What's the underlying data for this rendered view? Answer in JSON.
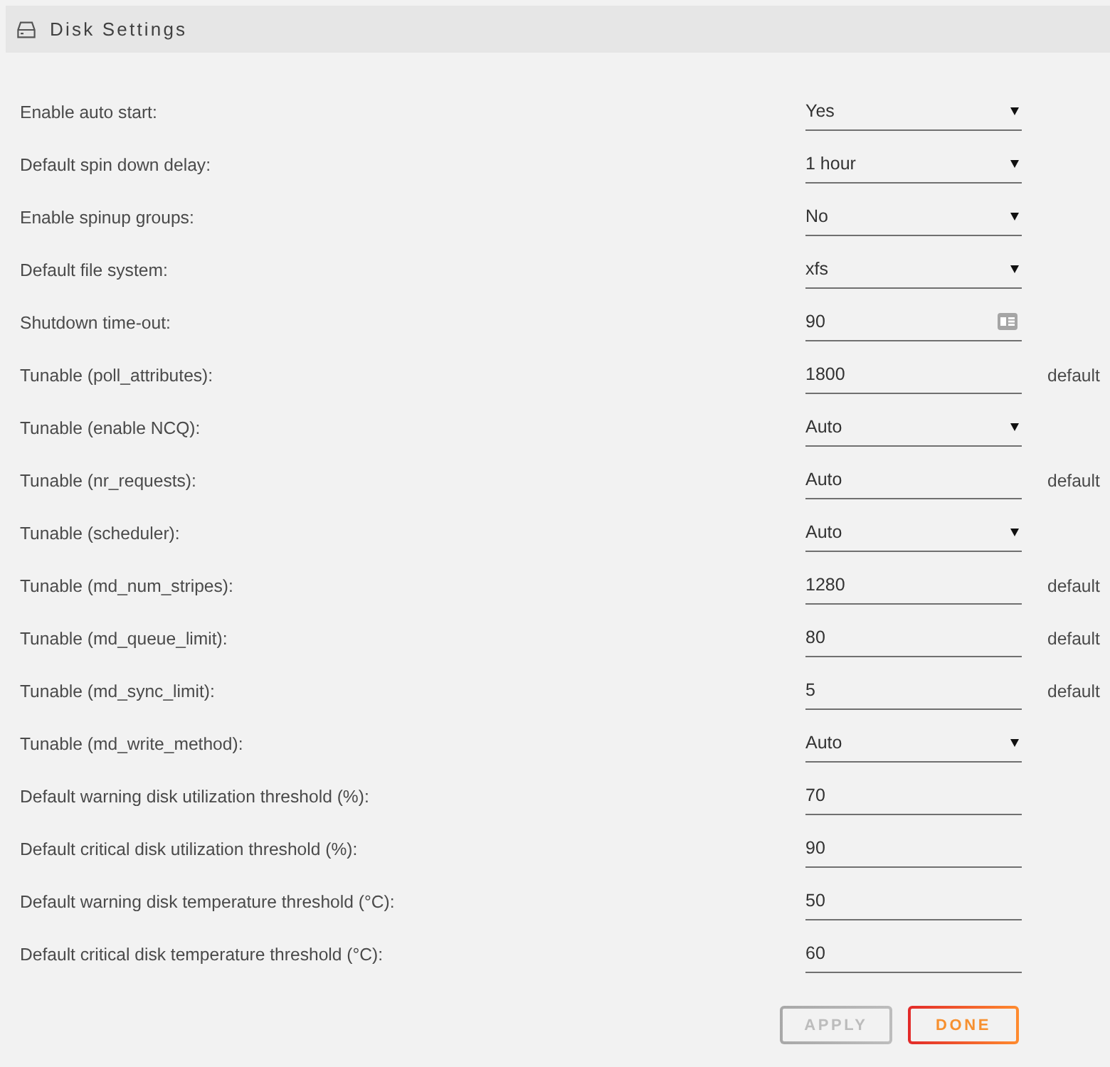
{
  "panel": {
    "title": "Disk Settings"
  },
  "settings": [
    {
      "label": "Enable auto start:",
      "kind": "select",
      "value": "Yes"
    },
    {
      "label": "Default spin down delay:",
      "kind": "select",
      "value": "1 hour"
    },
    {
      "label": "Enable spinup groups:",
      "kind": "select",
      "value": "No"
    },
    {
      "label": "Default file system:",
      "kind": "select",
      "value": "xfs"
    },
    {
      "label": "Shutdown time-out:",
      "kind": "help-input",
      "value": "90"
    },
    {
      "label": "Tunable (poll_attributes):",
      "kind": "input",
      "value": "1800",
      "note": "default"
    },
    {
      "label": "Tunable (enable NCQ):",
      "kind": "select",
      "value": "Auto"
    },
    {
      "label": "Tunable (nr_requests):",
      "kind": "input",
      "value": "Auto",
      "note": "default"
    },
    {
      "label": "Tunable (scheduler):",
      "kind": "select",
      "value": "Auto"
    },
    {
      "label": "Tunable (md_num_stripes):",
      "kind": "input",
      "value": "1280",
      "note": "default"
    },
    {
      "label": "Tunable (md_queue_limit):",
      "kind": "input",
      "value": "80",
      "note": "default"
    },
    {
      "label": "Tunable (md_sync_limit):",
      "kind": "input",
      "value": "5",
      "note": "default"
    },
    {
      "label": "Tunable (md_write_method):",
      "kind": "select",
      "value": "Auto"
    },
    {
      "label": "Default warning disk utilization threshold (%):",
      "kind": "input",
      "value": "70"
    },
    {
      "label": "Default critical disk utilization threshold (%):",
      "kind": "input",
      "value": "90"
    },
    {
      "label": "Default warning disk temperature threshold (°C):",
      "kind": "input",
      "value": "50"
    },
    {
      "label": "Default critical disk temperature threshold (°C):",
      "kind": "input",
      "value": "60"
    }
  ],
  "buttons": [
    {
      "label": "APPLY",
      "disabled": true
    },
    {
      "label": "DONE",
      "disabled": false
    }
  ]
}
